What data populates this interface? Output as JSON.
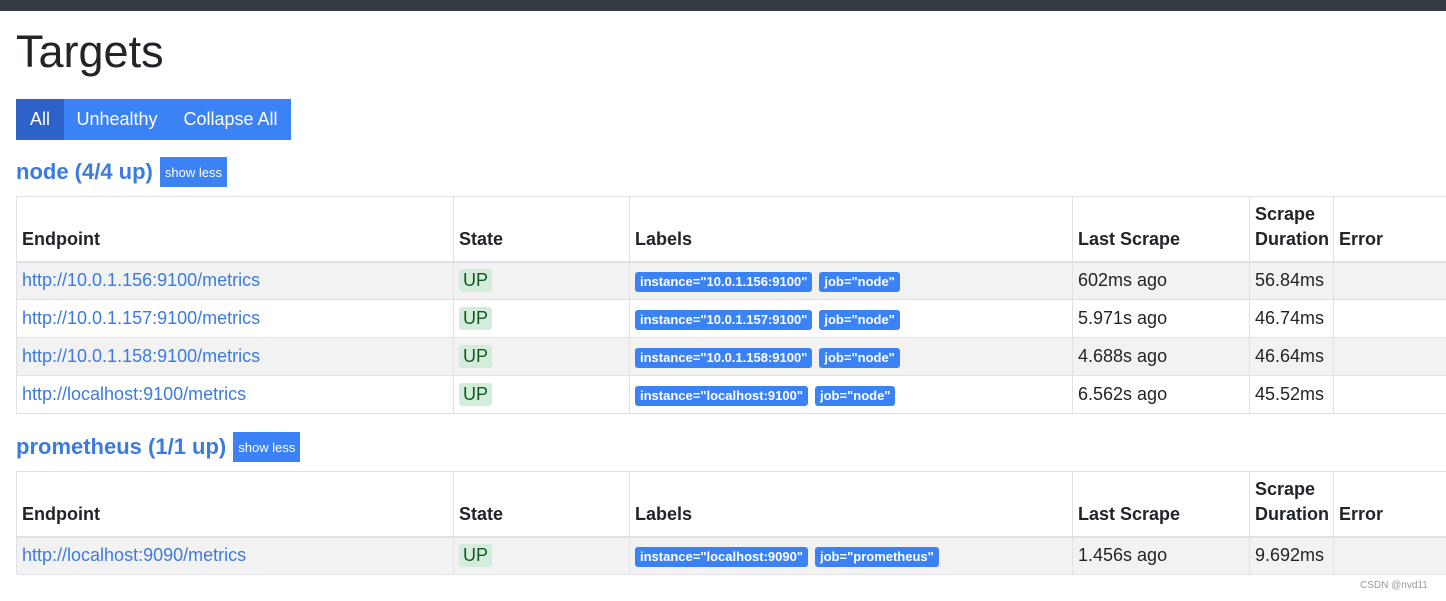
{
  "page": {
    "title": "Targets"
  },
  "filters": {
    "all": "All",
    "unhealthy": "Unhealthy",
    "collapse_all": "Collapse All"
  },
  "columns": {
    "endpoint": "Endpoint",
    "state": "State",
    "labels": "Labels",
    "last_scrape": "Last Scrape",
    "scrape_duration": "Scrape Duration",
    "error": "Error"
  },
  "pools": [
    {
      "title": "node (4/4 up)",
      "toggle": "show less",
      "targets": [
        {
          "endpoint": "http://10.0.1.156:9100/metrics",
          "state": "UP",
          "labels": [
            "instance=\"10.0.1.156:9100\"",
            "job=\"node\""
          ],
          "last_scrape": "602ms ago",
          "duration": "56.84ms",
          "error": ""
        },
        {
          "endpoint": "http://10.0.1.157:9100/metrics",
          "state": "UP",
          "labels": [
            "instance=\"10.0.1.157:9100\"",
            "job=\"node\""
          ],
          "last_scrape": "5.971s ago",
          "duration": "46.74ms",
          "error": ""
        },
        {
          "endpoint": "http://10.0.1.158:9100/metrics",
          "state": "UP",
          "labels": [
            "instance=\"10.0.1.158:9100\"",
            "job=\"node\""
          ],
          "last_scrape": "4.688s ago",
          "duration": "46.64ms",
          "error": ""
        },
        {
          "endpoint": "http://localhost:9100/metrics",
          "state": "UP",
          "labels": [
            "instance=\"localhost:9100\"",
            "job=\"node\""
          ],
          "last_scrape": "6.562s ago",
          "duration": "45.52ms",
          "error": ""
        }
      ]
    },
    {
      "title": "prometheus (1/1 up)",
      "toggle": "show less",
      "targets": [
        {
          "endpoint": "http://localhost:9090/metrics",
          "state": "UP",
          "labels": [
            "instance=\"localhost:9090\"",
            "job=\"prometheus\""
          ],
          "last_scrape": "1.456s ago",
          "duration": "9.692ms",
          "error": ""
        }
      ]
    }
  ],
  "watermark": "CSDN @nvd11"
}
